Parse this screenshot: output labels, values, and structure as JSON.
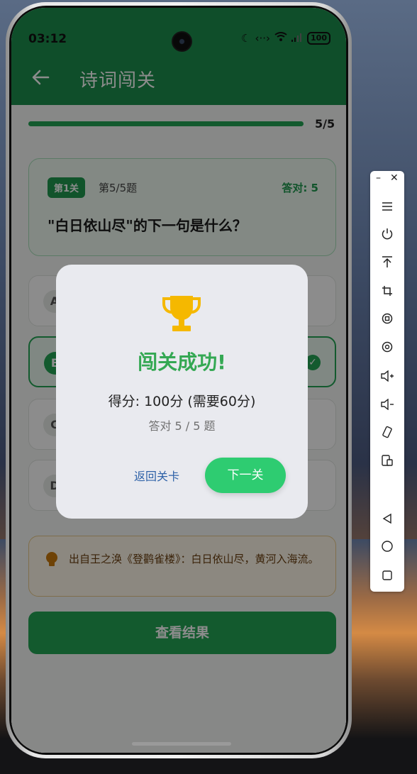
{
  "status_bar": {
    "time": "03:12",
    "network": "‹··›",
    "battery": "100"
  },
  "app_bar": {
    "title": "诗词闯关"
  },
  "progress": {
    "fraction": 1.0,
    "label": "5/5"
  },
  "question_card": {
    "level_badge": "第1关",
    "index_label": "第5/5题",
    "score_label": "答对: 5",
    "question": "\"白日依山尽\"的下一句是什么？"
  },
  "options": [
    {
      "letter": "A",
      "correct": false
    },
    {
      "letter": "B",
      "correct": true
    },
    {
      "letter": "C",
      "correct": false
    },
    {
      "letter": "D",
      "correct": false
    }
  ],
  "hint": {
    "text": "出自王之涣《登鹳雀楼》：白日依山尽，黄河入海流。"
  },
  "result_button": {
    "label": "查看结果"
  },
  "dialog": {
    "title": "闯关成功!",
    "score": "得分: 100分 (需要60分)",
    "answered": "答对 5 / 5 题",
    "back_button": "返回关卡",
    "next_button": "下一关"
  },
  "colors": {
    "primary": "#1d8f4d",
    "accent": "#2ecc71",
    "success_title": "#34a853",
    "trophy": "#f5b800",
    "link": "#2f62a8"
  },
  "toolbar": {
    "icons": [
      "menu-icon",
      "power-icon",
      "upload-icon",
      "crop-icon",
      "rotate-icon",
      "screenshot-icon",
      "volume-up-icon",
      "volume-down-icon",
      "screen-rotate-icon",
      "device-icon",
      "back-nav-icon",
      "home-nav-icon",
      "recent-nav-icon"
    ]
  }
}
